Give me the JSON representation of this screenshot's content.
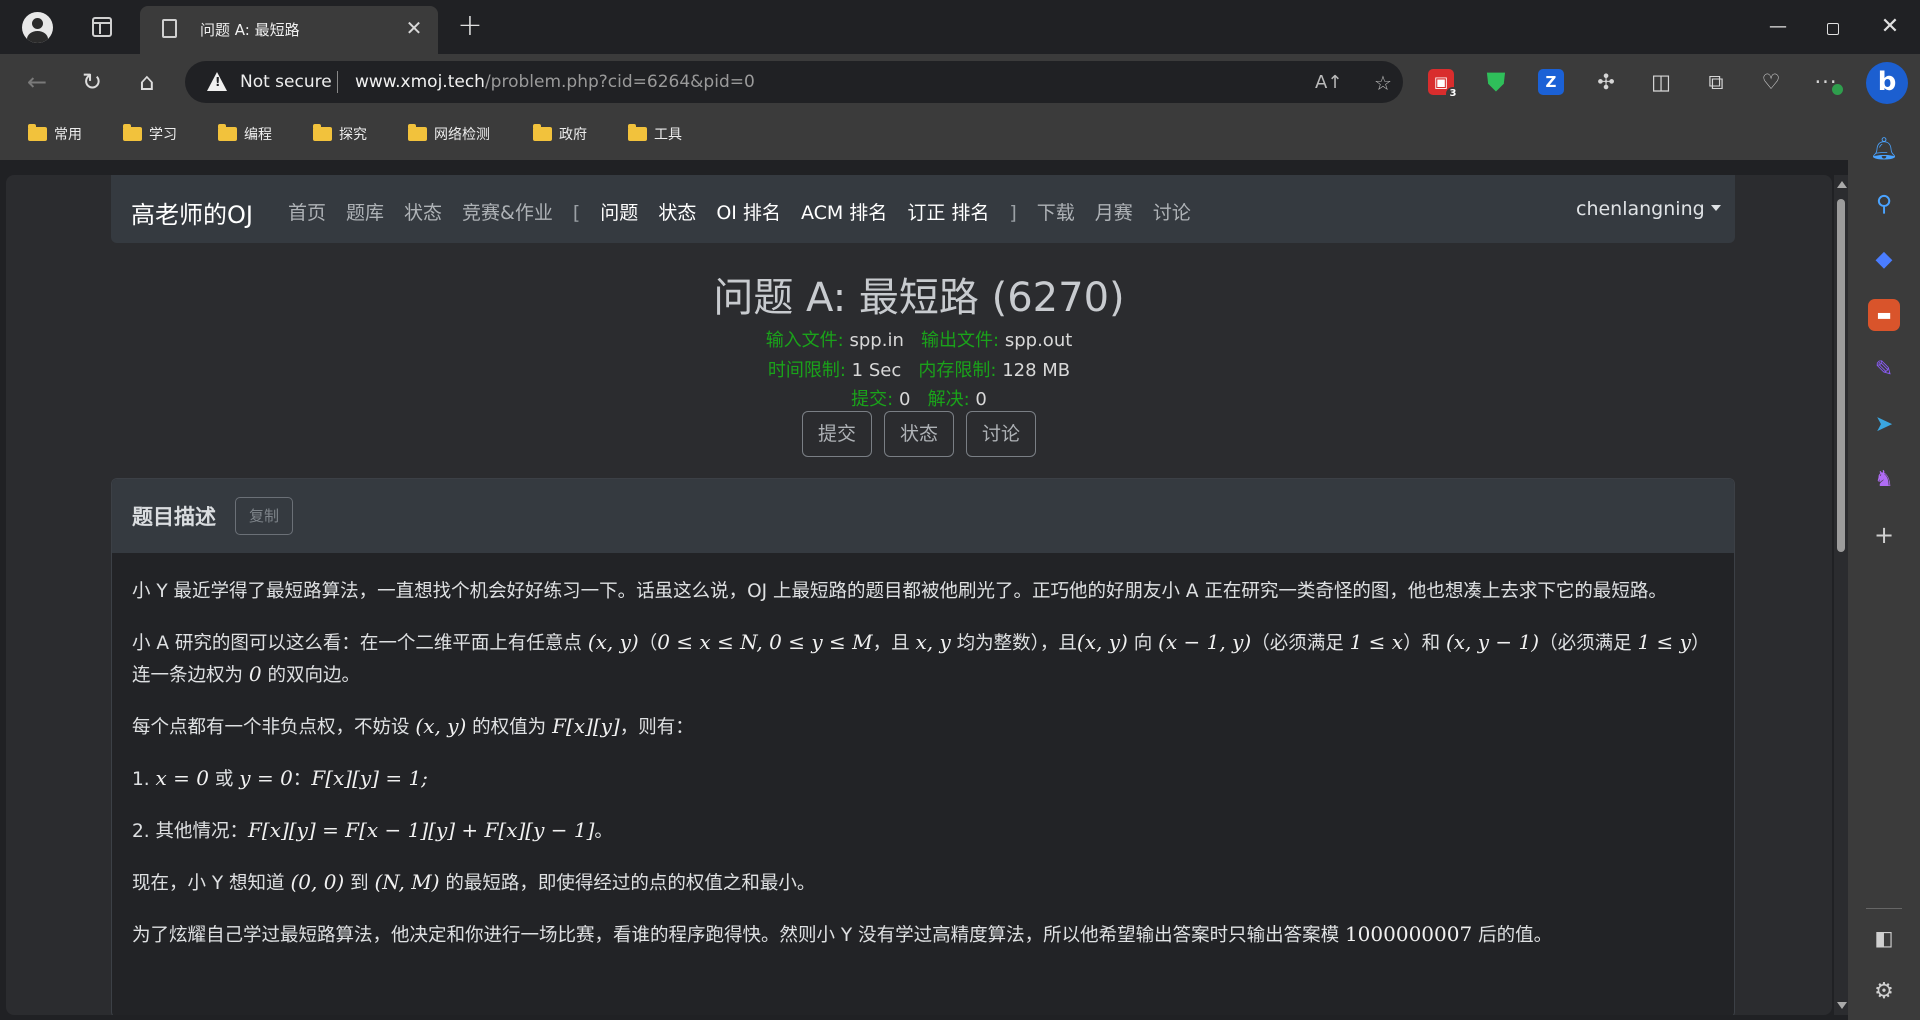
{
  "browser": {
    "tab_title": "问题 A: 最短路",
    "tab_close": "✕",
    "new_tab": "+",
    "security_label": "Not secure",
    "url_host": "www.xmoj.tech",
    "url_path": "/problem.php?cid=6264&pid=0",
    "extension_badge": "3",
    "bookmarks": [
      "常用",
      "学习",
      "编程",
      "探究",
      "网络检测",
      "政府",
      "工具"
    ]
  },
  "site": {
    "brand": "高老师的OJ",
    "nav_left": [
      "首页",
      "题库",
      "状态",
      "竞赛&作业"
    ],
    "bracket_open": "[",
    "nav_contest": [
      "问题",
      "状态",
      "OI 排名",
      "ACM 排名",
      "订正 排名"
    ],
    "bracket_close": "]",
    "nav_right": [
      "下载",
      "月赛",
      "讨论"
    ],
    "user": "chenlangning"
  },
  "problem": {
    "title": "问题 A: 最短路 (6270)",
    "input_label": "输入文件:",
    "input_value": "spp.in",
    "output_label": "输出文件:",
    "output_value": "spp.out",
    "time_label": "时间限制:",
    "time_value": "1 Sec",
    "memory_label": "内存限制:",
    "memory_value": "128 MB",
    "submit_label": "提交:",
    "submit_value": "0",
    "solved_label": "解决:",
    "solved_value": "0",
    "buttons": [
      "提交",
      "状态",
      "讨论"
    ]
  },
  "description": {
    "heading": "题目描述",
    "copy_button": "复制",
    "p1": "小 Y 最近学得了最短路算法，一直想找个机会好好练习一下。话虽这么说，OJ 上最短路的题目都被他刷光了。正巧他的好朋友小 A 正在研究一类奇怪的图，他也想凑上去求下它的最短路。",
    "p2": {
      "a": "小 A 研究的图可以这么看：在一个二维平面上有任意点 ",
      "m1": "(x, y)",
      "b": "（",
      "m2": "0 ≤ x ≤ N, 0 ≤ y ≤ M",
      "c": "，且 ",
      "m3": "x, y",
      "d": " 均为整数），且",
      "m4": "(x, y)",
      "e": " 向 ",
      "m5": "(x − 1, y)",
      "f": "（必须满足 ",
      "m6": "1 ≤ x",
      "g": "）和 ",
      "m7": "(x, y − 1)",
      "h": "（必须满足 ",
      "m8": "1 ≤ y",
      "i": "）连一条边权为 ",
      "m9": "0",
      "j": " 的双向边。"
    },
    "p3": {
      "a": "每个点都有一个非负点权，不妨设 ",
      "m1": "(x, y)",
      "b": " 的权值为 ",
      "m2": "F[x][y]",
      "c": "，则有："
    },
    "p4": {
      "a": "1. ",
      "m1": "x = 0",
      "b": " 或 ",
      "m2": "y = 0",
      "c": "：",
      "m3": "F[x][y] = 1;"
    },
    "p5": {
      "a": "2. 其他情况：",
      "m1": "F[x][y] = F[x − 1][y] + F[x][y − 1]",
      "b": "。"
    },
    "p6": {
      "a": "现在，小 Y 想知道 ",
      "m1": "(0, 0)",
      "b": " 到 ",
      "m2": "(N, M)",
      "c": " 的最短路，即使得经过的点的权值之和最小。"
    },
    "p7": {
      "a": "为了炫耀自己学过最短路算法，他决定和你进行一场比赛，看谁的程序跑得快。然则小 Y 没有学过高精度算法，所以他希望输出答案时只输出答案模 ",
      "m1": "1000000007",
      "b": " 后的值。"
    }
  }
}
